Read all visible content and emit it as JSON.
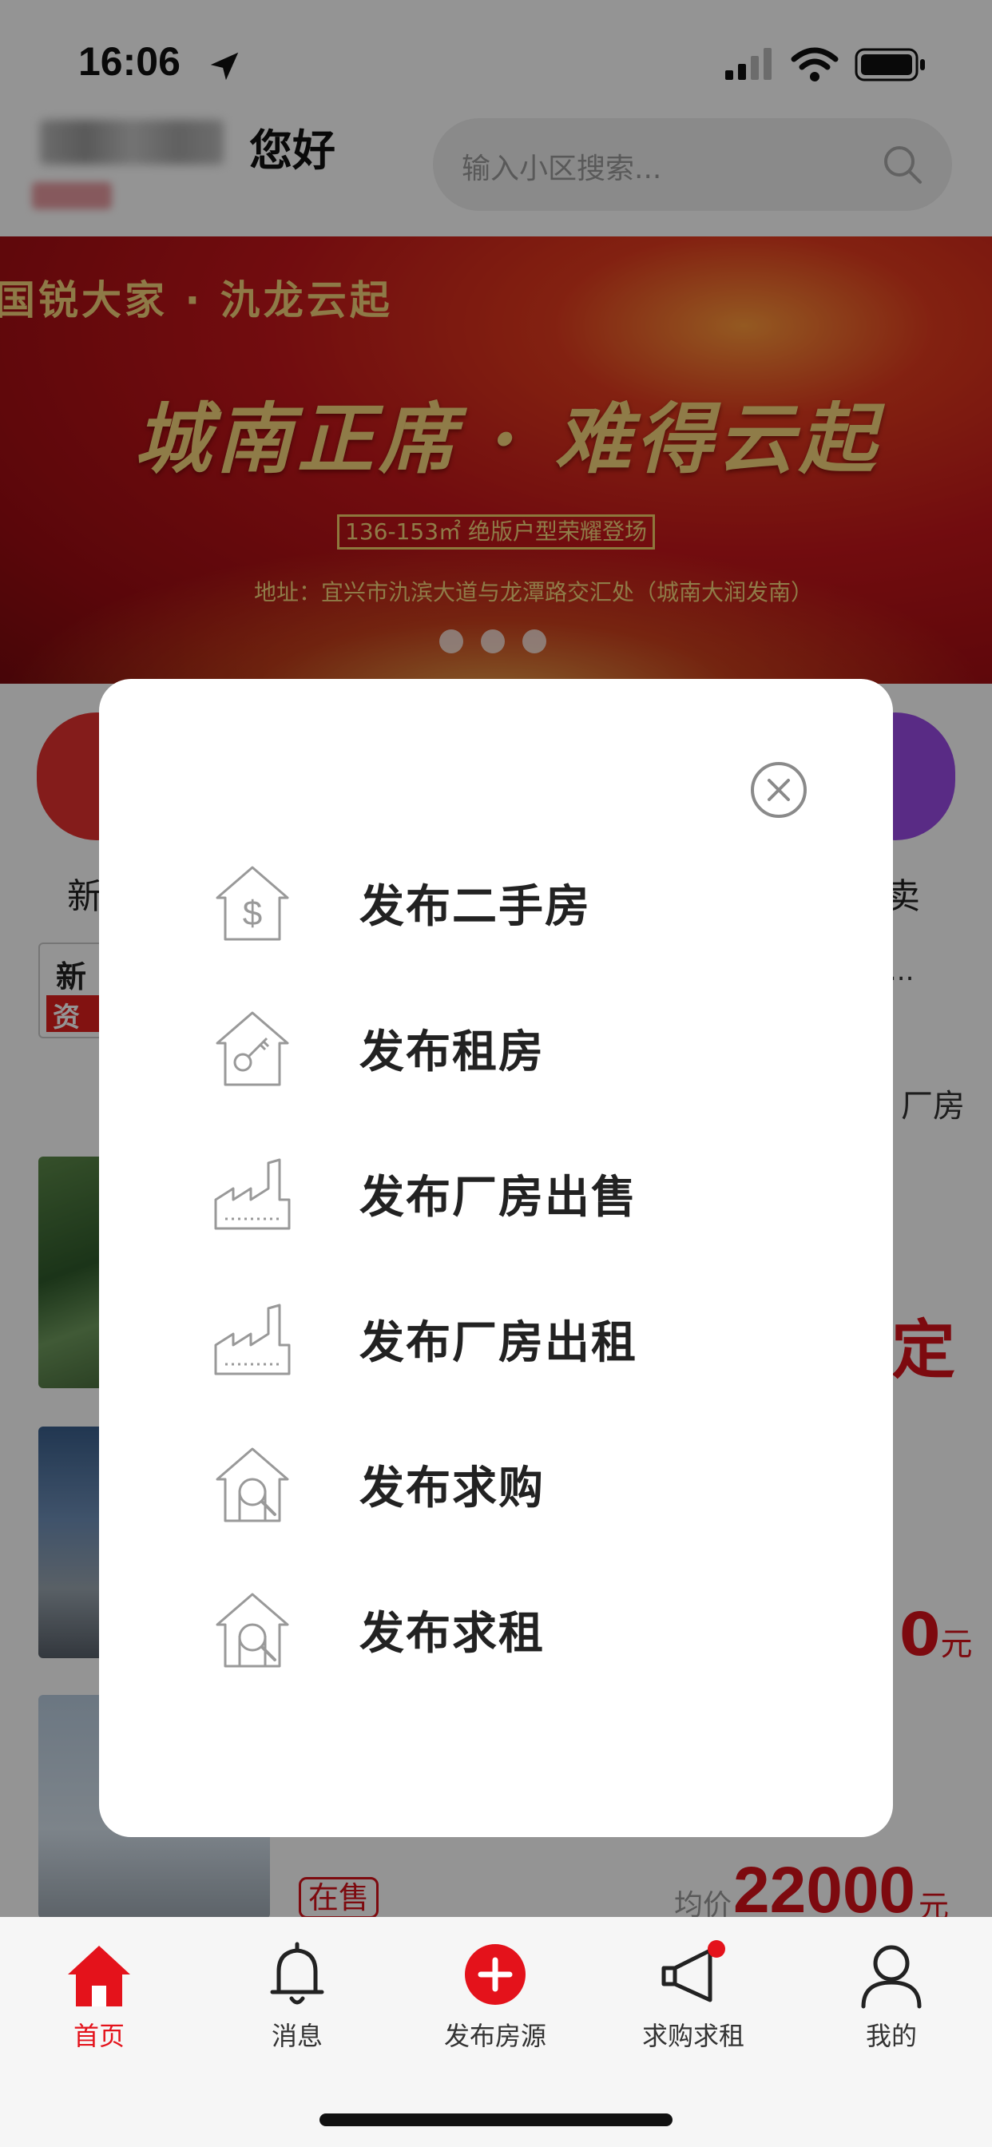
{
  "status_bar": {
    "time": "16:06"
  },
  "header": {
    "greeting": "您好",
    "search_placeholder": "输入小区搜索..."
  },
  "banner": {
    "tagline": "国锐大家 · 氿龙云起",
    "title": "城南正席 · 难得云起",
    "subtitle_box": "136-153㎡ 绝版户型荣耀登场",
    "address": "地址：宜兴市氿滨大道与龙潭路交汇处（城南大润发南）"
  },
  "background": {
    "cat_left_label": "新",
    "cat_right_label": "卖",
    "cat_right_dots": "...",
    "news_badge_top": "新",
    "news_badge_bottom": "资",
    "right_fragment_1": "厂房",
    "right_fragment_2": "定",
    "right_fragment_3_value": "0",
    "right_fragment_3_unit": "元",
    "listing_status": "在售",
    "listing_price_label": "均价",
    "listing_price_value": "22000",
    "listing_price_unit": "元"
  },
  "modal": {
    "items": [
      {
        "label": "发布二手房",
        "icon": "house-dollar-icon"
      },
      {
        "label": "发布租房",
        "icon": "house-key-icon"
      },
      {
        "label": "发布厂房出售",
        "icon": "factory-icon"
      },
      {
        "label": "发布厂房出租",
        "icon": "factory-icon"
      },
      {
        "label": "发布求购",
        "icon": "house-search-icon"
      },
      {
        "label": "发布求租",
        "icon": "house-search-icon"
      }
    ]
  },
  "tabbar": {
    "tabs": [
      {
        "label": "首页",
        "icon": "home-icon",
        "active": true
      },
      {
        "label": "消息",
        "icon": "bell-icon",
        "active": false
      },
      {
        "label": "发布房源",
        "icon": "plus-circle-icon",
        "active": false
      },
      {
        "label": "求购求租",
        "icon": "megaphone-icon",
        "active": false
      },
      {
        "label": "我的",
        "icon": "user-icon",
        "active": false
      }
    ]
  },
  "colors": {
    "accent": "#e4121b",
    "overlay": "rgba(0,0,0,0.42)"
  }
}
